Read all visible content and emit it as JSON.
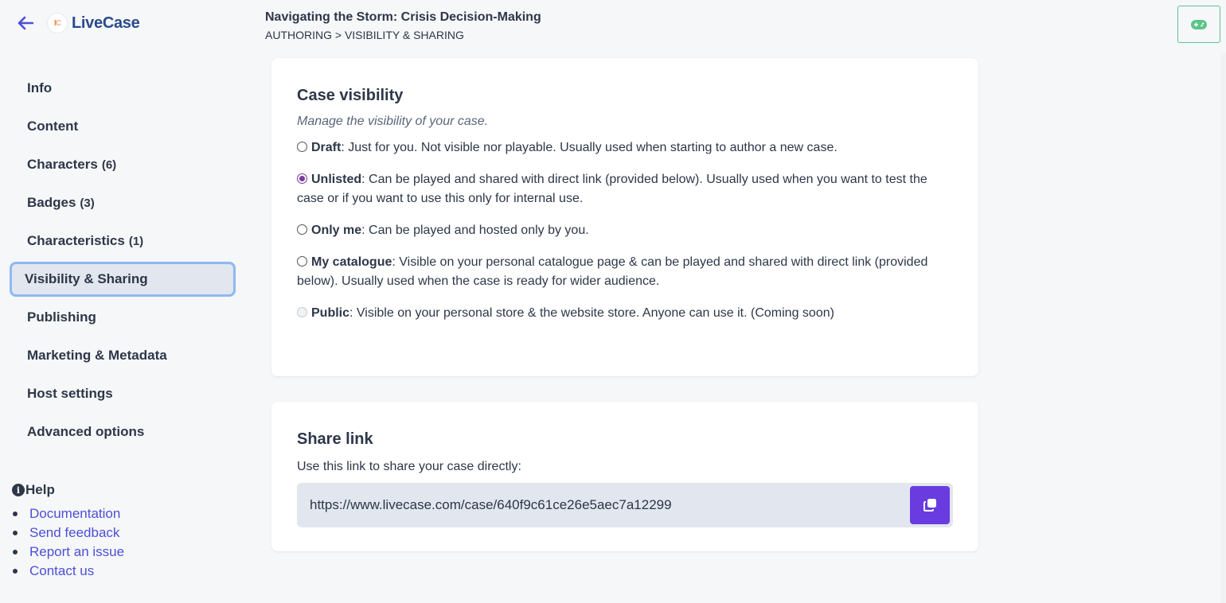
{
  "app": {
    "name": "LiveCase",
    "logo_letters": [
      "I",
      "C"
    ],
    "back_icon": "arrow-left-icon",
    "play_icon": "gamepad-icon"
  },
  "header": {
    "title": "Navigating the Storm: Crisis Decision-Making",
    "breadcrumb": "AUTHORING > VISIBILITY & SHARING"
  },
  "sidebar": {
    "items": [
      {
        "label": "Info",
        "count": ""
      },
      {
        "label": "Content",
        "count": ""
      },
      {
        "label": "Characters",
        "count": "(6)"
      },
      {
        "label": "Badges",
        "count": "(3)"
      },
      {
        "label": "Characteristics",
        "count": "(1)"
      },
      {
        "label": "Visibility & Sharing",
        "count": "",
        "active": true
      },
      {
        "label": "Publishing",
        "count": ""
      },
      {
        "label": "Marketing & Metadata",
        "count": ""
      },
      {
        "label": "Host settings",
        "count": ""
      },
      {
        "label": "Advanced options",
        "count": ""
      }
    ]
  },
  "help": {
    "title": "Help",
    "links": [
      "Documentation",
      "Send feedback",
      "Report an issue",
      "Contact us"
    ]
  },
  "visibility": {
    "title": "Case visibility",
    "subtitle": "Manage the visibility of your case.",
    "selected": "Unlisted",
    "options": [
      {
        "name": "Draft",
        "description": ": Just for you. Not visible nor playable. Usually used when starting to author a new case."
      },
      {
        "name": "Unlisted",
        "description": ": Can be played and shared with direct link (provided below). Usually used when you want to test the case or if you want to use this only for internal use."
      },
      {
        "name": "Only me",
        "description": ": Can be played and hosted only by you."
      },
      {
        "name": "My catalogue",
        "description": ": Visible on your personal catalogue page & can be played and shared with direct link (provided below). Usually used when the case is ready for wider audience."
      },
      {
        "name": "Public",
        "description": ": Visible on your personal store & the website store. Anyone can use it. (Coming soon)",
        "disabled": true
      }
    ]
  },
  "share": {
    "title": "Share link",
    "description": "Use this link to share your case directly:",
    "url": "https://www.livecase.com/case/640f9c61ce26e5aec7a12299",
    "copy_icon": "copy-icon"
  },
  "colors": {
    "accent": "#6a3ce0",
    "link": "#4c4fd6",
    "brand": "#2a4a8c",
    "play_border": "#5cc48a",
    "radio_checked": "#7c3aa0",
    "active_border": "#8fb8f2"
  }
}
